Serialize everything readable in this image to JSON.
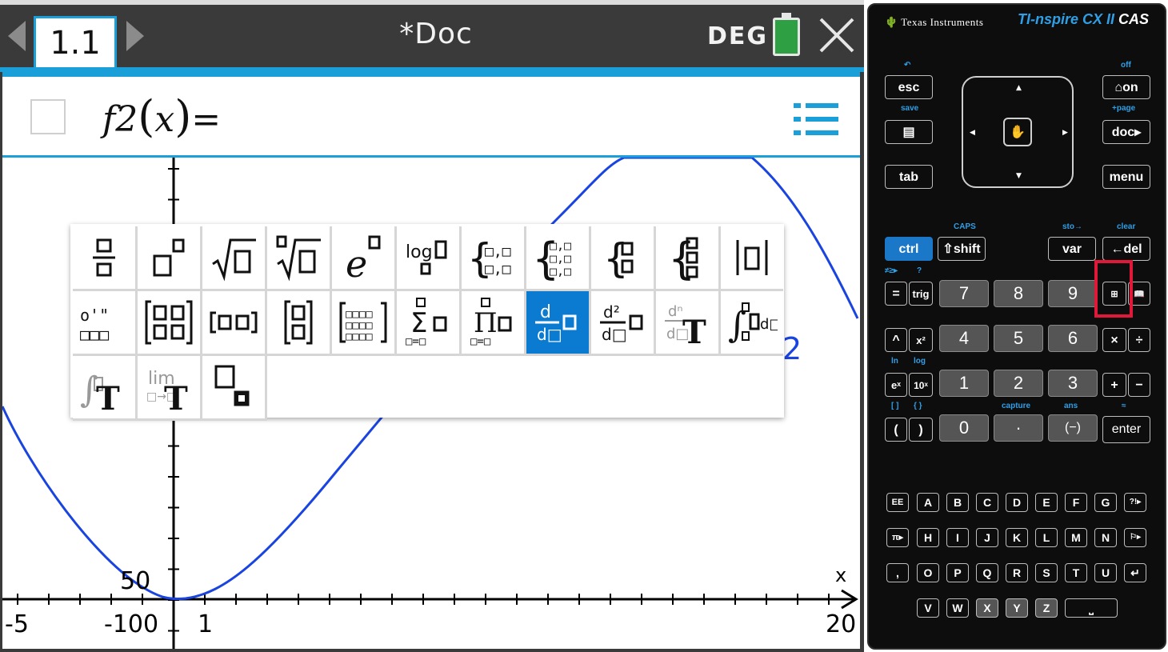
{
  "header": {
    "tab_label": "1.1",
    "doc_title": "*Doc",
    "angle_mode": "DEG"
  },
  "entry_line": {
    "func_name": "f2",
    "var": "x",
    "equals": "="
  },
  "graph": {
    "x_min_label": "-5",
    "x_max_label": "20",
    "x_tick_label": "1",
    "y_upper_label": "50",
    "y_lower_label": "-100",
    "axis_var": "x",
    "partial_label": "2",
    "curve_color": "#1a44e0"
  },
  "palette": {
    "selected": "derivative",
    "row1": [
      "fraction",
      "exponent",
      "square-root",
      "nth-root",
      "e-power",
      "log-base",
      "piecewise-2",
      "piecewise-3",
      "system-2",
      "system-3",
      "absolute-value"
    ],
    "row2": [
      "degree-minute-second",
      "matrix-2x2",
      "row-vector",
      "column-vector",
      "matrix-mxn",
      "sum",
      "product",
      "derivative",
      "second-derivative",
      "nth-derivative",
      "definite-integral"
    ],
    "row3": [
      "indefinite-integral",
      "limit",
      "subscript"
    ]
  },
  "calculator": {
    "brand": "Texas Instruments",
    "model_prefix": "TI-",
    "model_name": "nspire",
    "model_suffix": " CX II ",
    "model_cas": "CAS",
    "keys": {
      "esc": "esc",
      "on": "on",
      "doc": "doc",
      "tab": "tab",
      "menu": "menu",
      "ctrl": "ctrl",
      "shift": "shift",
      "var": "var",
      "del": "del",
      "equals": "=",
      "trig": "trig",
      "k7": "7",
      "k8": "8",
      "k9": "9",
      "caret": "^",
      "x2": "x²",
      "k4": "4",
      "k5": "5",
      "k6": "6",
      "times": "×",
      "divide": "÷",
      "ex": "eˣ",
      "tenx": "10ˣ",
      "k1": "1",
      "k2": "2",
      "k3": "3",
      "plus": "+",
      "minus": "−",
      "lparen": "(",
      "rparen": ")",
      "k0": "0",
      "dot": "·",
      "neg": "(−)",
      "enter": "enter",
      "ee": "EE",
      "pi": "π▸",
      "comma": ",",
      "flag": "⚐▸",
      "qmark": "?!▸",
      "ret": "↵",
      "space": "⎵",
      "alpha": [
        "A",
        "B",
        "C",
        "D",
        "E",
        "F",
        "G",
        "H",
        "I",
        "J",
        "K",
        "L",
        "M",
        "N",
        "O",
        "P",
        "Q",
        "R",
        "S",
        "T",
        "U",
        "V",
        "W",
        "X",
        "Y",
        "Z"
      ]
    },
    "labels": {
      "save": "save",
      "off": "off",
      "page": "+page",
      "caps": "CAPS",
      "sto": "sto→",
      "clear": "clear",
      "ln": "ln",
      "log": "log",
      "capture": "capture",
      "ans": "ans",
      "brackets": "[ ]",
      "braces": "{ }",
      "approx": "≈",
      "neq": "≠≥▸",
      "help": "?"
    }
  }
}
